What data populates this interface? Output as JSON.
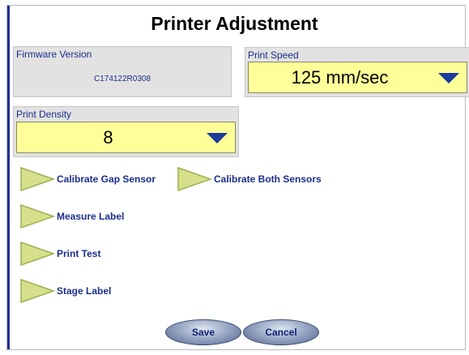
{
  "title": "Printer Adjustment",
  "firmware": {
    "label": "Firmware Version",
    "value": "C174122R0308"
  },
  "print_speed": {
    "label": "Print Speed",
    "value": "125 mm/sec"
  },
  "print_density": {
    "label": "Print Density",
    "value": "8"
  },
  "actions": {
    "calibrate_gap": "Calibrate Gap Sensor",
    "calibrate_both": "Calibrate Both Sensors",
    "measure_label": "Measure Label",
    "print_test": "Print Test",
    "stage_label": "Stage Label"
  },
  "buttons": {
    "save": "Save",
    "cancel": "Cancel"
  },
  "colors": {
    "accent_text": "#1a2e8c",
    "select_bg": "#ffff99",
    "dropdown_arrow": "#1a3a9c",
    "play_icon": "#d6e08a",
    "frame_edge": "#1d2f8f"
  },
  "icons": {
    "dropdown": "triangle-down-icon",
    "action": "play-triangle-icon"
  }
}
